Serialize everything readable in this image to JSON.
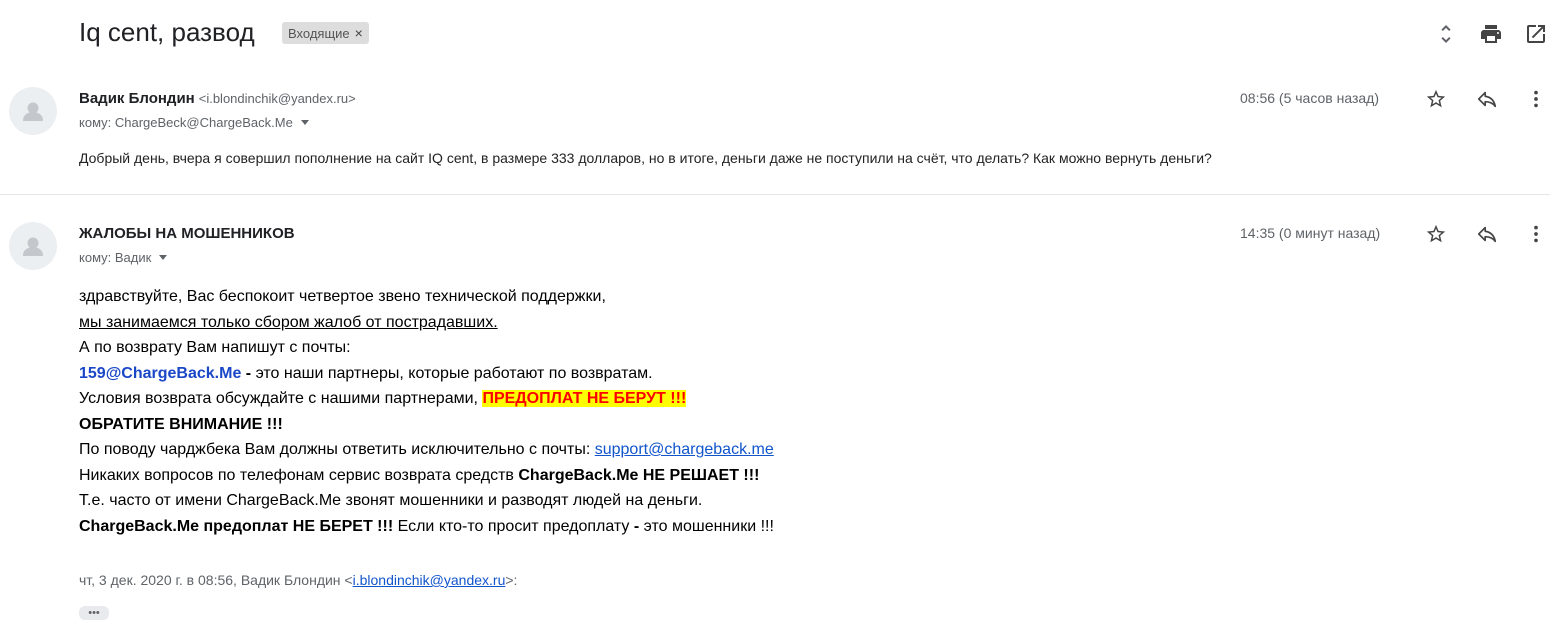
{
  "header": {
    "subject": "Iq cent, развод",
    "label": "Входящие",
    "label_remove": "×",
    "icons": [
      "expand-collapse-icon",
      "print-icon",
      "open-in-new-window-icon"
    ]
  },
  "messages": [
    {
      "sender_name": "Вадик Блондин",
      "sender_email": "<i.blondinchik@yandex.ru>",
      "to": "кому: ChargeBeck@ChargeBack.Me",
      "time": "08:56 (5 часов назад)",
      "snippet": "Добрый день, вчера я совершил пополнение на сайт IQ cent, в размере 333 долларов, но в итоге, деньги даже не поступили на счёт, что делать? Как можно вернуть деньги?"
    },
    {
      "sender_name": "ЖАЛОБЫ НА МОШЕННИКОВ",
      "to": "кому: Вадик",
      "time": "14:35 (0 минут назад)",
      "body": {
        "l1": "здравствуйте, Вас беспокоит четвертое звено технической поддержки,",
        "l2": "мы занимаемся только сбором жалоб от пострадавших.",
        "l3": "А по возврату Вам напишут с почты:",
        "l4_email": "159@ChargeBack.Me",
        "l4_dash": " - ",
        "l4_rest": "это наши партнеры, которые работают по возвратам.",
        "l5_text": "Условия возврата обсуждайте с нашими партнерами, ",
        "l5_highlight": "ПРЕДОПЛАТ НЕ БЕРУТ !!!",
        "l6": "ОБРАТИТЕ ВНИМАНИЕ !!!",
        "l7_text": "По поводу чарджбека Вам должны ответить исключительно с почты: ",
        "l7_link": "support@chargeback.me",
        "l8_text": "Никаких вопросов по телефонам сервис возврата средств ",
        "l8_bold": "ChargeBack.Me НЕ РЕШАЕТ !!!",
        "l9": "Т.е. часто от имени ChargeBack.Me звонят мошенники и разводят людей на деньги.",
        "l10_bold": "ChargeBack.Me предоплат НЕ БЕРЕТ !!!",
        "l10_text": " Если кто-то просит предоплату ",
        "l10_dash": "-",
        "l10_end": " это мошенники !!!"
      },
      "quote_prefix": "чт, 3 дек. 2020 г. в 08:56, Вадик Блондин <",
      "quote_email": "i.blondinchik@yandex.ru",
      "quote_suffix": ">:",
      "expand_label": "•••"
    }
  ]
}
